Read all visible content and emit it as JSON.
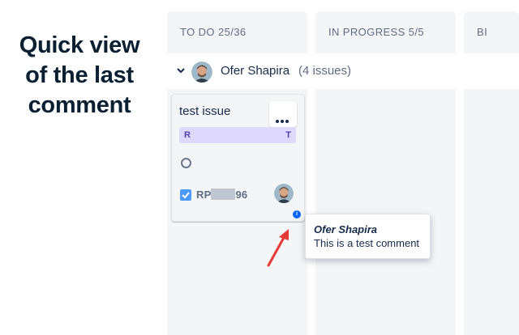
{
  "promo": {
    "lines": [
      "Quick view",
      "of the last",
      "comment"
    ]
  },
  "board": {
    "columns": [
      {
        "title": "TO DO 25/36"
      },
      {
        "title": "IN PROGRESS 5/5"
      },
      {
        "title": "BI"
      }
    ],
    "swimlane": {
      "assignee": "Ofer Shapira",
      "count_label": "(4 issues)"
    },
    "card": {
      "title": "test issue",
      "epic_left": "R",
      "epic_right": "T",
      "key_prefix": "RP",
      "key_suffix": "96"
    }
  },
  "tooltip": {
    "author": "Ofer Shapira",
    "comment": "This is a test comment"
  },
  "colors": {
    "accent": "#0065ff",
    "arrow": "#e53935",
    "epic_bg": "#dfd8fd"
  }
}
